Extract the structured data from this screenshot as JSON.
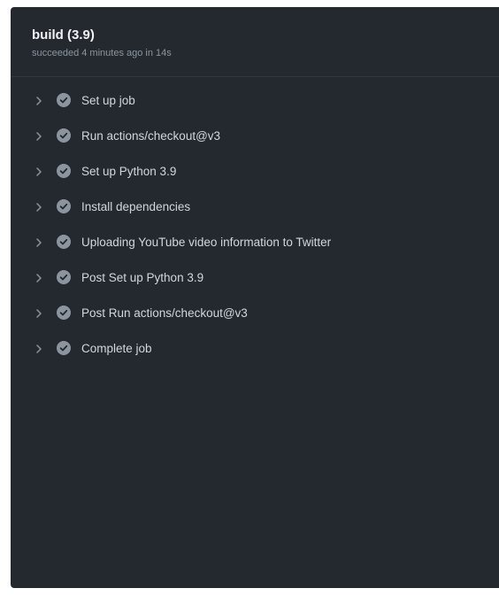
{
  "job": {
    "title": "build (3.9)",
    "meta": "succeeded 4 minutes ago in 14s"
  },
  "steps": [
    {
      "label": "Set up job",
      "status": "success",
      "icon": "check-circle-icon"
    },
    {
      "label": "Run actions/checkout@v3",
      "status": "success",
      "icon": "check-circle-icon"
    },
    {
      "label": "Set up Python 3.9",
      "status": "success",
      "icon": "check-circle-icon"
    },
    {
      "label": "Install dependencies",
      "status": "success",
      "icon": "check-circle-icon"
    },
    {
      "label": "Uploading YouTube video information to Twitter",
      "status": "success",
      "icon": "check-circle-icon"
    },
    {
      "label": "Post Set up Python 3.9",
      "status": "success",
      "icon": "check-circle-icon"
    },
    {
      "label": "Post Run actions/checkout@v3",
      "status": "success",
      "icon": "check-circle-icon"
    },
    {
      "label": "Complete job",
      "status": "success",
      "icon": "check-circle-icon"
    }
  ],
  "colors": {
    "panel_bg": "#24292f",
    "title": "#f0f3f6",
    "meta": "#8c959f",
    "step_text": "#d0d7de",
    "status_icon": "#8c959f",
    "chevron": "#8c959f"
  }
}
